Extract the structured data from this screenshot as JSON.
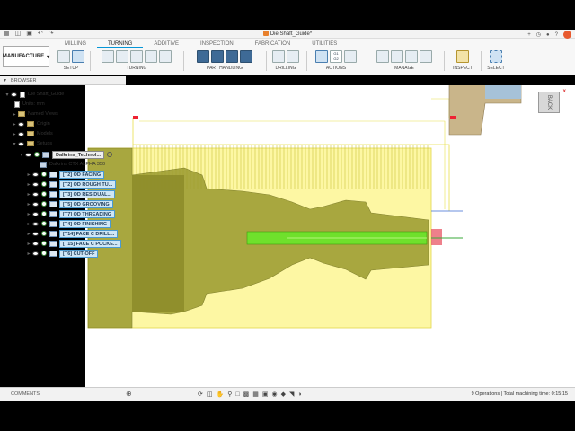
{
  "title_bar": {
    "document_title": "Die Shaft_Guide*",
    "left_icons": [
      "grid-icon",
      "file-icon",
      "save-icon",
      "undo-icon",
      "redo-icon"
    ],
    "right_icons": [
      "plus-icon",
      "clock-icon",
      "help-icon",
      "bell-icon",
      "question-icon"
    ]
  },
  "toolbar": {
    "workspace_label": "MANUFACTURE",
    "tabs": [
      "MILLING",
      "TURNING",
      "ADDITIVE",
      "INSPECTION",
      "FABRICATION",
      "UTILITIES"
    ],
    "active_tab": "TURNING",
    "groups": {
      "setup": "SETUP",
      "turning": "TURNING",
      "part_handling": "PART HANDLING",
      "drilling": "DRILLING",
      "actions": "ACTIONS",
      "manage": "MANAGE",
      "inspect": "INSPECT",
      "select": "SELECT"
    },
    "actions_glyph_1": "G1",
    "actions_glyph_2": "G2"
  },
  "browser": {
    "header": "BROWSER",
    "root": "Die Shaft_Guide",
    "units": "Units: mm",
    "named_views": "Named Views",
    "origin": "Origin",
    "models": "Models",
    "setups": "Setups",
    "setup_name": "Dalkrins_Technol...",
    "machine": "Dalkrins CTX ALPHA 350",
    "operations": [
      "[T2] OD FACING",
      "[T2] OD ROUGH TU...",
      "[T3] OD RESIDUAL...",
      "[T5] OD GROOVING",
      "[T7] OD THREADING",
      "[T4] OD FINISHING",
      "[T14] FACE C DRILL...",
      "[T15] FACE C POCKE...",
      "[T6] CUT-OFF"
    ]
  },
  "viewcube": {
    "face_label": "BACK"
  },
  "statusbar": {
    "comments": "COMMENTS",
    "summary": "9 Operations | Total machining time: 0:15:15"
  },
  "colors": {
    "stock": "#fdf7a3",
    "part": "#9a9a2e",
    "toolpath": "#e8e04a",
    "accent": "#0696d7",
    "drill": "#6fe02c"
  }
}
